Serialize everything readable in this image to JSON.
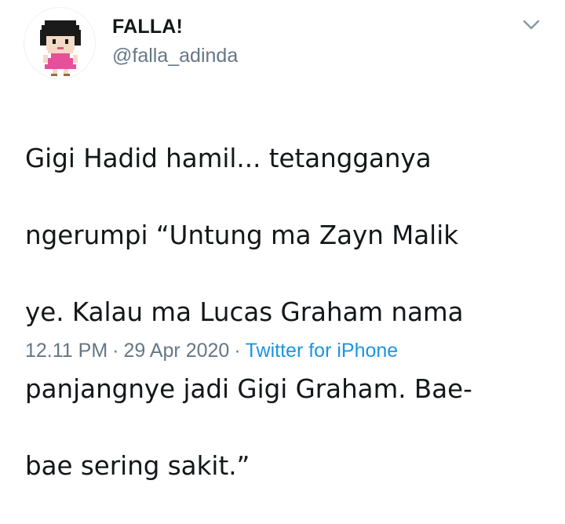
{
  "user": {
    "display_name": "FALLA!",
    "handle": "@falla_adinda"
  },
  "tweet": {
    "text_lines": [
      "Gigi Hadid hamil... tetangganya",
      "ngerumpi “Untung ma Zayn Malik",
      "ye. Kalau ma Lucas Graham nama",
      "panjangnye jadi Gigi Graham. Bae-",
      "bae sering sakit.”"
    ],
    "time": "12.11 PM",
    "date": "29 Apr 2020",
    "source": "Twitter for iPhone",
    "separator": "·"
  },
  "icons": {
    "avatar": "pixel-art-girl-avatar",
    "menu": "chevron-down-icon"
  },
  "colors": {
    "text": "#14171a",
    "secondary": "#657786",
    "link": "#1b95e0",
    "background": "#ffffff"
  }
}
